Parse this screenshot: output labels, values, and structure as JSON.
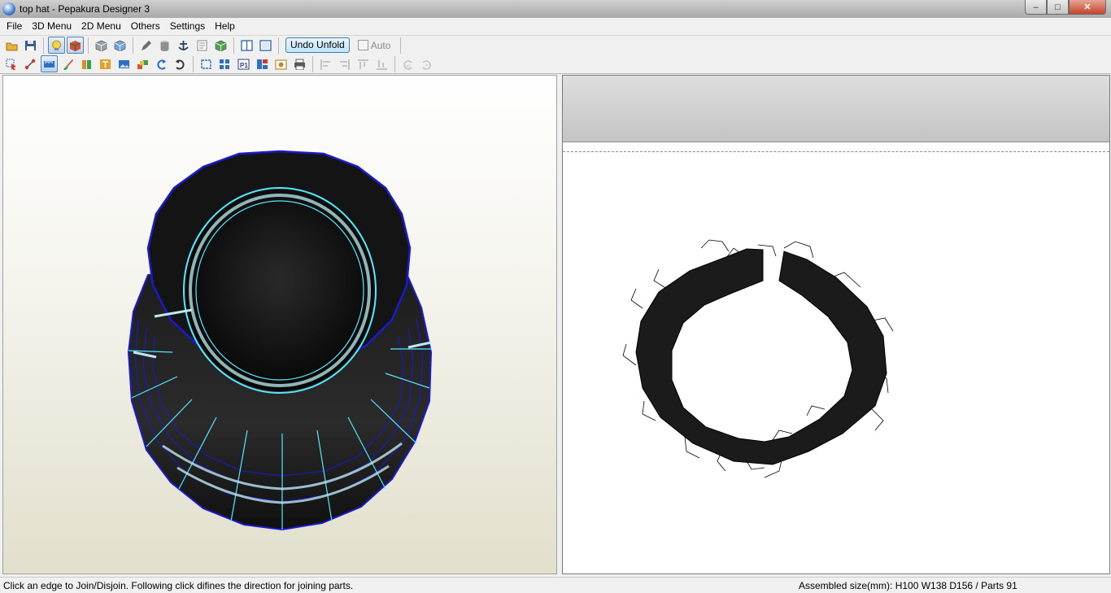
{
  "window": {
    "title": "top hat - Pepakura Designer 3",
    "controls": {
      "minimize": "–",
      "maximize": "□",
      "close": "✕"
    }
  },
  "menu": [
    {
      "id": "file",
      "label": "File"
    },
    {
      "id": "3d-menu",
      "label": "3D Menu"
    },
    {
      "id": "2d-menu",
      "label": "2D Menu"
    },
    {
      "id": "others",
      "label": "Others"
    },
    {
      "id": "settings",
      "label": "Settings"
    },
    {
      "id": "help",
      "label": "Help"
    }
  ],
  "toolbar": {
    "row1": [
      {
        "name": "open-folder-icon",
        "glyph": "folder",
        "color": "#e8b23a"
      },
      {
        "name": "save-disk-icon",
        "glyph": "disk",
        "color": "#3c5a8a"
      },
      {
        "name": "sep"
      },
      {
        "name": "light-bulb-icon",
        "glyph": "bulb",
        "color": "#f6d44a",
        "active": true
      },
      {
        "name": "texture-cube-icon",
        "glyph": "cube",
        "color": "#e0463a",
        "active": true
      },
      {
        "name": "sep"
      },
      {
        "name": "wire-cube-icon",
        "glyph": "box",
        "color": "#9aa0a6"
      },
      {
        "name": "blue-cube-icon",
        "glyph": "box",
        "color": "#6fa7d8"
      },
      {
        "name": "sep"
      },
      {
        "name": "pencil-icon",
        "glyph": "pencil",
        "color": "#6c6c6c"
      },
      {
        "name": "cylinder-icon",
        "glyph": "cyl",
        "color": "#8f8f8f"
      },
      {
        "name": "anchor-icon",
        "glyph": "anchor",
        "color": "#2c3e5a"
      },
      {
        "name": "sheet-icon",
        "glyph": "sheet",
        "color": "#8a8a8a"
      },
      {
        "name": "green-cube-icon",
        "glyph": "box",
        "color": "#4fa34a"
      },
      {
        "name": "sep"
      },
      {
        "name": "split-view-icon",
        "glyph": "split",
        "color": "#3c6fb0"
      },
      {
        "name": "single-view-icon",
        "glyph": "single",
        "color": "#3c6fb0"
      }
    ],
    "undo_unfold": "Undo Unfold",
    "auto": "Auto",
    "row2": [
      {
        "name": "select-pointer-icon",
        "glyph": "pointer",
        "color": "#d03a2a"
      },
      {
        "name": "join-edge-icon",
        "glyph": "edge",
        "color": "#d03a2a"
      },
      {
        "name": "ruler-icon",
        "glyph": "ruler",
        "color": "#2c6fc4",
        "active": true
      },
      {
        "name": "paint-brush-icon",
        "glyph": "brush",
        "color": "#3aa24a"
      },
      {
        "name": "flap-icon",
        "glyph": "flap",
        "color": "#e28a2a"
      },
      {
        "name": "text-tool-icon",
        "glyph": "text",
        "color": "#e2a22a"
      },
      {
        "name": "image-icon",
        "glyph": "image",
        "color": "#2c6fc4"
      },
      {
        "name": "move-part-icon",
        "glyph": "cubes",
        "color": "#d05a2a"
      },
      {
        "name": "rotate-left-icon",
        "glyph": "rot",
        "color": "#2c6fc4"
      },
      {
        "name": "rotate-right-icon",
        "glyph": "rot2",
        "color": "#3a3a3a"
      },
      {
        "name": "sep"
      },
      {
        "name": "select-frame-icon",
        "glyph": "frame",
        "color": "#2c6fc4"
      },
      {
        "name": "arrange-parts-icon",
        "glyph": "grid",
        "color": "#2c6fc4"
      },
      {
        "name": "page-number-icon",
        "glyph": "p1",
        "color": "#2c3e8a"
      },
      {
        "name": "page-layout-icon",
        "glyph": "layout",
        "color": "#2c6fc4"
      },
      {
        "name": "save-image-icon",
        "glyph": "photo",
        "color": "#c08a2a"
      },
      {
        "name": "print-icon",
        "glyph": "printer",
        "color": "#5a5a5a"
      },
      {
        "name": "sep"
      },
      {
        "name": "align-left-icon",
        "glyph": "alignl",
        "color": "#8f8f8f",
        "dim": true
      },
      {
        "name": "align-right-icon",
        "glyph": "alignr",
        "color": "#8f8f8f",
        "dim": true
      },
      {
        "name": "align-top-icon",
        "glyph": "alignt",
        "color": "#8f8f8f",
        "dim": true
      },
      {
        "name": "align-bottom-icon",
        "glyph": "alignb",
        "color": "#8f8f8f",
        "dim": true
      },
      {
        "name": "sep"
      },
      {
        "name": "rotate-90-icon",
        "glyph": "r90",
        "color": "#8f8f8f",
        "dim": true
      },
      {
        "name": "rotate-free-icon",
        "glyph": "rfree",
        "color": "#8f8f8f",
        "dim": true
      }
    ]
  },
  "status": {
    "hint": "Click an edge to Join/Disjoin. Following click difines the direction for joining parts.",
    "assembled": "Assembled size(mm): H100 W138 D156 / Parts 91"
  },
  "colors": {
    "mesh_edge": "#1a1ad0",
    "selected_edge": "#56e8ff",
    "model_fill": "#121212",
    "part_fill": "#1b1b1b"
  }
}
